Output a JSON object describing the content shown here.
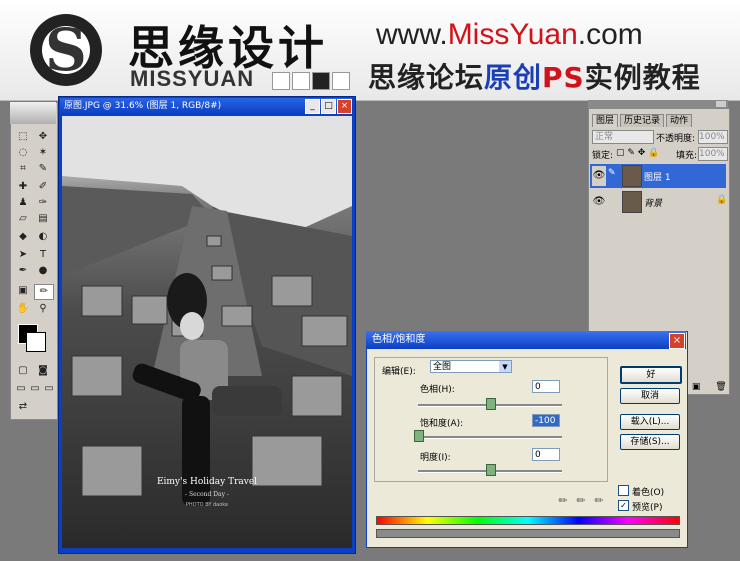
{
  "banner": {
    "cn_title": "思缘设计",
    "en_title": "MISSYUAN",
    "url_prefix": "www.",
    "url_m": "Miss",
    "url_y": "Yuan",
    "url_suffix": ".com",
    "subtitle_a": "思缘论坛",
    "subtitle_b": "原创",
    "subtitle_c": "PS",
    "subtitle_d": "实例教程"
  },
  "image_window": {
    "title": "原图.JPG @ 31.6% (图层 1, RGB/8#)",
    "photo_text1": "Eimy's Holiday Travel",
    "photo_text2": "- Second Day -",
    "photo_text3": "PHOTO BY daoke"
  },
  "layers_panel": {
    "tabs": [
      "图层",
      "历史记录",
      "动作"
    ],
    "blend_mode": "正常",
    "opacity_label": "不透明度:",
    "opacity_value": "100%",
    "lock_label": "锁定:",
    "fill_label": "填充:",
    "fill_value": "100%",
    "layers": [
      {
        "name": "图层 1",
        "selected": true
      },
      {
        "name": "背景",
        "selected": false
      }
    ]
  },
  "dialog": {
    "title": "色相/饱和度",
    "edit_label": "编辑(E):",
    "edit_value": "全图",
    "hue_label": "色相(H):",
    "hue_value": "0",
    "hue_level": 0.5,
    "sat_label": "饱和度(A):",
    "sat_value": "-100",
    "sat_level": 0,
    "light_label": "明度(I):",
    "light_value": "0",
    "light_level": 0.5,
    "ok": "好",
    "cancel": "取消",
    "load": "载入(L)...",
    "save": "存储(S)...",
    "colorize": "着色(O)",
    "colorize_checked": false,
    "preview": "预览(P)",
    "preview_checked": true
  },
  "colors": {
    "accent_red": "#d0121b",
    "accent_blue": "#1a3fb5",
    "titlebar_blue": "#0b3fc4",
    "selected_layer": "#3168d5"
  }
}
